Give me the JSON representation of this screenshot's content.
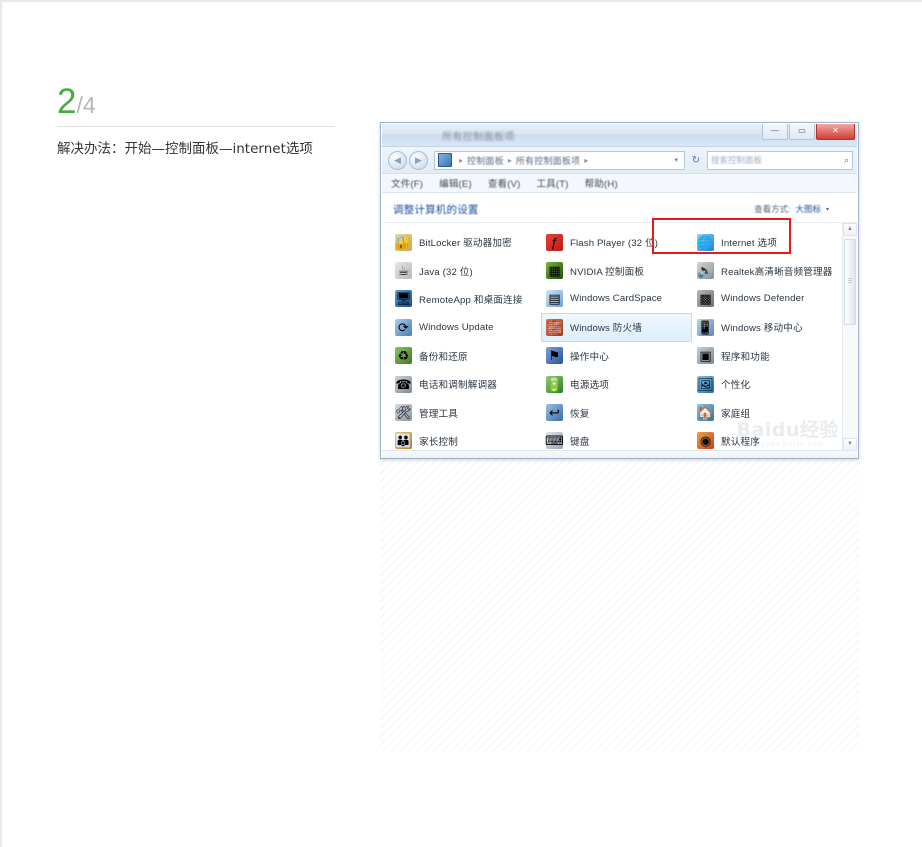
{
  "step": {
    "current": "2",
    "separator": "/",
    "total": "4",
    "description": "解决办法：开始—控制面板—internet选项"
  },
  "window": {
    "title_caption": "所有控制面板项",
    "controls": {
      "minimize": "—",
      "maximize": "▭",
      "close": "✕"
    },
    "nav": {
      "back": "◀",
      "forward": "▶",
      "refresh": "↻",
      "dropdown_caret": "▾"
    },
    "breadcrumb": {
      "icon": "control-panel-icon",
      "items": [
        "控制面板",
        "所有控制面板项"
      ],
      "separator": "▸",
      "trailing_separator": "▸"
    },
    "search": {
      "placeholder": "搜索控制面板",
      "icon": "search-icon"
    },
    "menubar": [
      "文件(F)",
      "编辑(E)",
      "查看(V)",
      "工具(T)",
      "帮助(H)"
    ],
    "content_header": {
      "title": "调整计算机的设置",
      "view_by_label": "查看方式:",
      "view_by_value": "大图标",
      "view_by_caret": "▾"
    },
    "scrollbar": {
      "up_arrow": "▲",
      "down_arrow": "▼"
    }
  },
  "control_panel_items": [
    [
      {
        "label": "BitLocker 驱动器加密",
        "icon": "bitlocker-icon",
        "glyph": "🔐",
        "color1": "#e8d79a",
        "color2": "#c9a94f",
        "state": "normal"
      },
      {
        "label": "Flash Player (32 位)",
        "icon": "flash-player-icon",
        "glyph": "ƒ",
        "color1": "#e8413a",
        "color2": "#b81b18",
        "state": "normal"
      },
      {
        "label": "Internet 选项",
        "icon": "internet-options-icon",
        "glyph": "🌐",
        "color1": "#9ecbf0",
        "color2": "#2a7cc7",
        "state": "highlighted"
      }
    ],
    [
      {
        "label": "Java (32 位)",
        "icon": "java-icon",
        "glyph": "☕",
        "color1": "#e6e6e6",
        "color2": "#b9b9b9",
        "state": "normal"
      },
      {
        "label": "NVIDIA 控制面板",
        "icon": "nvidia-icon",
        "glyph": "▦",
        "color1": "#7bb53a",
        "color2": "#1f4d10",
        "state": "normal"
      },
      {
        "label": "Realtek高清晰音频管理器",
        "icon": "realtek-audio-icon",
        "glyph": "🔊",
        "color1": "#d7d7d7",
        "color2": "#8d8d8d",
        "state": "normal"
      }
    ],
    [
      {
        "label": "RemoteApp 和桌面连接",
        "icon": "remoteapp-icon",
        "glyph": "🖥",
        "color1": "#5e9bd6",
        "color2": "#1b4f8c",
        "state": "normal"
      },
      {
        "label": "Windows CardSpace",
        "icon": "cardspace-icon",
        "glyph": "▤",
        "color1": "#cfe4f5",
        "color2": "#6ca3d6",
        "state": "normal"
      },
      {
        "label": "Windows Defender",
        "icon": "defender-icon",
        "glyph": "▩",
        "color1": "#b9b9b9",
        "color2": "#6d6d6d",
        "state": "normal"
      }
    ],
    [
      {
        "label": "Windows Update",
        "icon": "windows-update-icon",
        "glyph": "⟳",
        "color1": "#a9cdea",
        "color2": "#4a7fb3",
        "state": "normal"
      },
      {
        "label": "Windows 防火墙",
        "icon": "firewall-icon",
        "glyph": "🧱",
        "color1": "#d0764a",
        "color2": "#8e3c1c",
        "state": "hovered"
      },
      {
        "label": "Windows 移动中心",
        "icon": "mobility-center-icon",
        "glyph": "📱",
        "color1": "#bcd4e8",
        "color2": "#5e87ae",
        "state": "normal"
      }
    ],
    [
      {
        "label": "备份和还原",
        "icon": "backup-restore-icon",
        "glyph": "♻",
        "color1": "#8ec45f",
        "color2": "#3f7a26",
        "state": "normal"
      },
      {
        "label": "操作中心",
        "icon": "action-center-icon",
        "glyph": "⚑",
        "color1": "#7fa3dd",
        "color2": "#2b4f99",
        "state": "normal"
      },
      {
        "label": "程序和功能",
        "icon": "programs-features-icon",
        "glyph": "▣",
        "color1": "#c8cfd6",
        "color2": "#7d8794",
        "state": "normal"
      }
    ],
    [
      {
        "label": "电话和调制解调器",
        "icon": "phone-modem-icon",
        "glyph": "☎",
        "color1": "#cbd2d8",
        "color2": "#808a94",
        "state": "normal"
      },
      {
        "label": "电源选项",
        "icon": "power-options-icon",
        "glyph": "🔋",
        "color1": "#8fcf6a",
        "color2": "#2f7a2a",
        "state": "normal"
      },
      {
        "label": "个性化",
        "icon": "personalization-icon",
        "glyph": "🖼",
        "color1": "#7ec2e8",
        "color2": "#2c6ea8",
        "state": "normal"
      }
    ],
    [
      {
        "label": "管理工具",
        "icon": "admin-tools-icon",
        "glyph": "🛠",
        "color1": "#d2dae2",
        "color2": "#8b97a4",
        "state": "normal"
      },
      {
        "label": "恢复",
        "icon": "recovery-icon",
        "glyph": "↩",
        "color1": "#9cc0e4",
        "color2": "#3a6da8",
        "state": "normal"
      },
      {
        "label": "家庭组",
        "icon": "homegroup-icon",
        "glyph": "🏠",
        "color1": "#8fc4ec",
        "color2": "#2e6fae",
        "state": "normal"
      }
    ],
    [
      {
        "label": "家长控制",
        "icon": "parental-controls-icon",
        "glyph": "👪",
        "color1": "#e3c978",
        "color2": "#a8832e",
        "state": "normal"
      },
      {
        "label": "键盘",
        "icon": "keyboard-icon",
        "glyph": "⌨",
        "color1": "#dfe4e9",
        "color2": "#9aa4ae",
        "state": "normal"
      },
      {
        "label": "默认程序",
        "icon": "default-programs-icon",
        "glyph": "◉",
        "color1": "#e8a54a",
        "color2": "#c0411f",
        "state": "normal"
      }
    ]
  ],
  "watermark": {
    "main": "Baidu经验",
    "sub": "jingyan.baidu.com"
  }
}
